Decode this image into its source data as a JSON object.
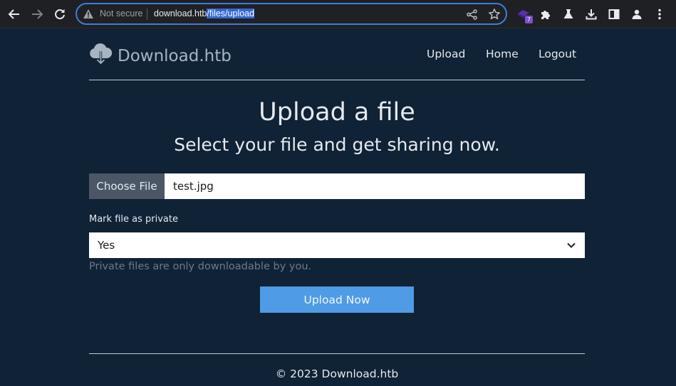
{
  "browser": {
    "security_label": "Not secure",
    "url_host": "download.htb",
    "url_path": "/files/upload",
    "extension_badge": "7",
    "icons": [
      "back-arrow-icon",
      "forward-arrow-icon",
      "reload-icon",
      "warning-icon",
      "share-icon",
      "star-icon",
      "extension-icon",
      "puzzle-icon",
      "flask-icon",
      "download-icon",
      "sidepanel-icon",
      "profile-icon",
      "more-menu-icon"
    ]
  },
  "site": {
    "brand": "Download.htb",
    "nav": [
      "Upload",
      "Home",
      "Logout"
    ]
  },
  "main": {
    "title": "Upload a file",
    "subtitle": "Select your file and get sharing now.",
    "file_button": "Choose File",
    "file_name": "test.jpg",
    "private_label": "Mark file as private",
    "private_value": "Yes",
    "private_help": "Private files are only downloadable by you.",
    "submit_label": "Upload Now"
  },
  "footer": {
    "text": "© 2023 Download.htb"
  },
  "colors": {
    "background": "#0f2236",
    "accent_button": "#4f9be6",
    "choose_button": "#4b5766"
  }
}
